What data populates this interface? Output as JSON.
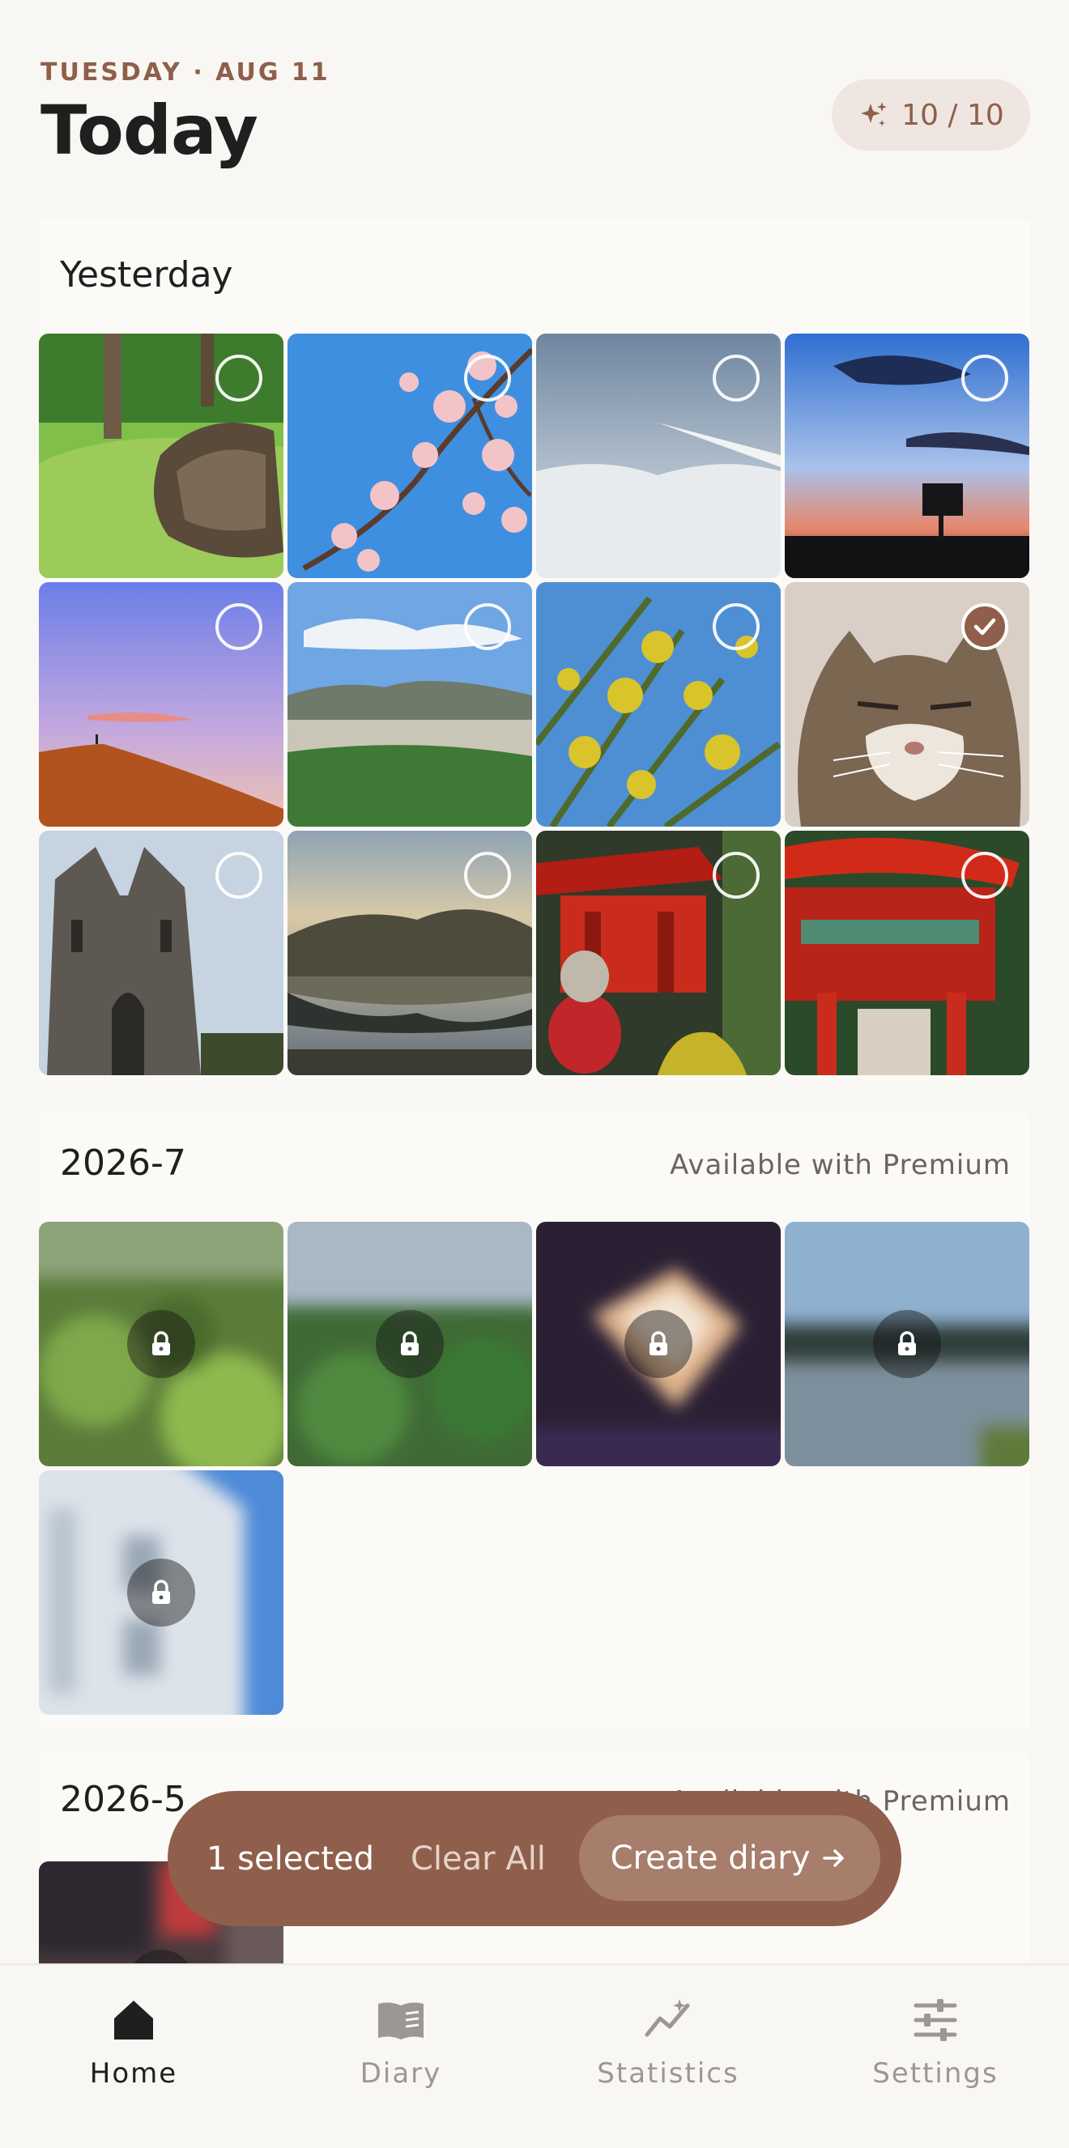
{
  "header": {
    "date": "TUESDAY · AUG 11",
    "title": "Today",
    "quota": "10 / 10"
  },
  "sections": [
    {
      "title": "Yesterday",
      "premium_note": "",
      "photos": [
        {
          "subject": "tree-stump-in-park",
          "selected": false,
          "locked": false
        },
        {
          "subject": "cherry-blossom-branch",
          "selected": false,
          "locked": false
        },
        {
          "subject": "airplane-wing-over-clouds",
          "selected": false,
          "locked": false
        },
        {
          "subject": "sunset-sky",
          "selected": false,
          "locked": false
        },
        {
          "subject": "hill-at-dusk",
          "selected": false,
          "locked": false
        },
        {
          "subject": "town-landscape",
          "selected": false,
          "locked": false
        },
        {
          "subject": "yellow-flowers",
          "selected": false,
          "locked": false
        },
        {
          "subject": "tabby-cat",
          "selected": true,
          "locked": false
        },
        {
          "subject": "cathedral",
          "selected": false,
          "locked": false
        },
        {
          "subject": "river-reflection",
          "selected": false,
          "locked": false
        },
        {
          "subject": "shrine-with-fox-statue",
          "selected": false,
          "locked": false
        },
        {
          "subject": "red-shrine-gate",
          "selected": false,
          "locked": false
        }
      ]
    },
    {
      "title": "2026-7",
      "premium_note": "Available with Premium",
      "photos": [
        {
          "subject": "green-lotus-leaves",
          "selected": false,
          "locked": true
        },
        {
          "subject": "pond-with-leaves",
          "selected": false,
          "locked": true
        },
        {
          "subject": "cake-slice",
          "selected": false,
          "locked": true
        },
        {
          "subject": "lake-reflection",
          "selected": false,
          "locked": true
        },
        {
          "subject": "white-building",
          "selected": false,
          "locked": true
        }
      ]
    },
    {
      "title": "2026-5",
      "premium_note": "Available with Premium",
      "photos": [
        {
          "subject": "street-scene",
          "selected": false,
          "locked": true
        }
      ]
    }
  ],
  "selection_bar": {
    "count_text": "1 selected",
    "clear_label": "Clear All",
    "create_label": "Create diary"
  },
  "nav": {
    "items": [
      {
        "label": "Home",
        "icon": "home-icon",
        "active": true
      },
      {
        "label": "Diary",
        "icon": "book-icon",
        "active": false
      },
      {
        "label": "Statistics",
        "icon": "chart-icon",
        "active": false
      },
      {
        "label": "Settings",
        "icon": "sliders-icon",
        "active": false
      }
    ]
  },
  "colors": {
    "accent": "#8f5f4b",
    "background": "#f9f7f3",
    "badge_bg": "#efe6e1",
    "button_light": "#a77d6c"
  }
}
